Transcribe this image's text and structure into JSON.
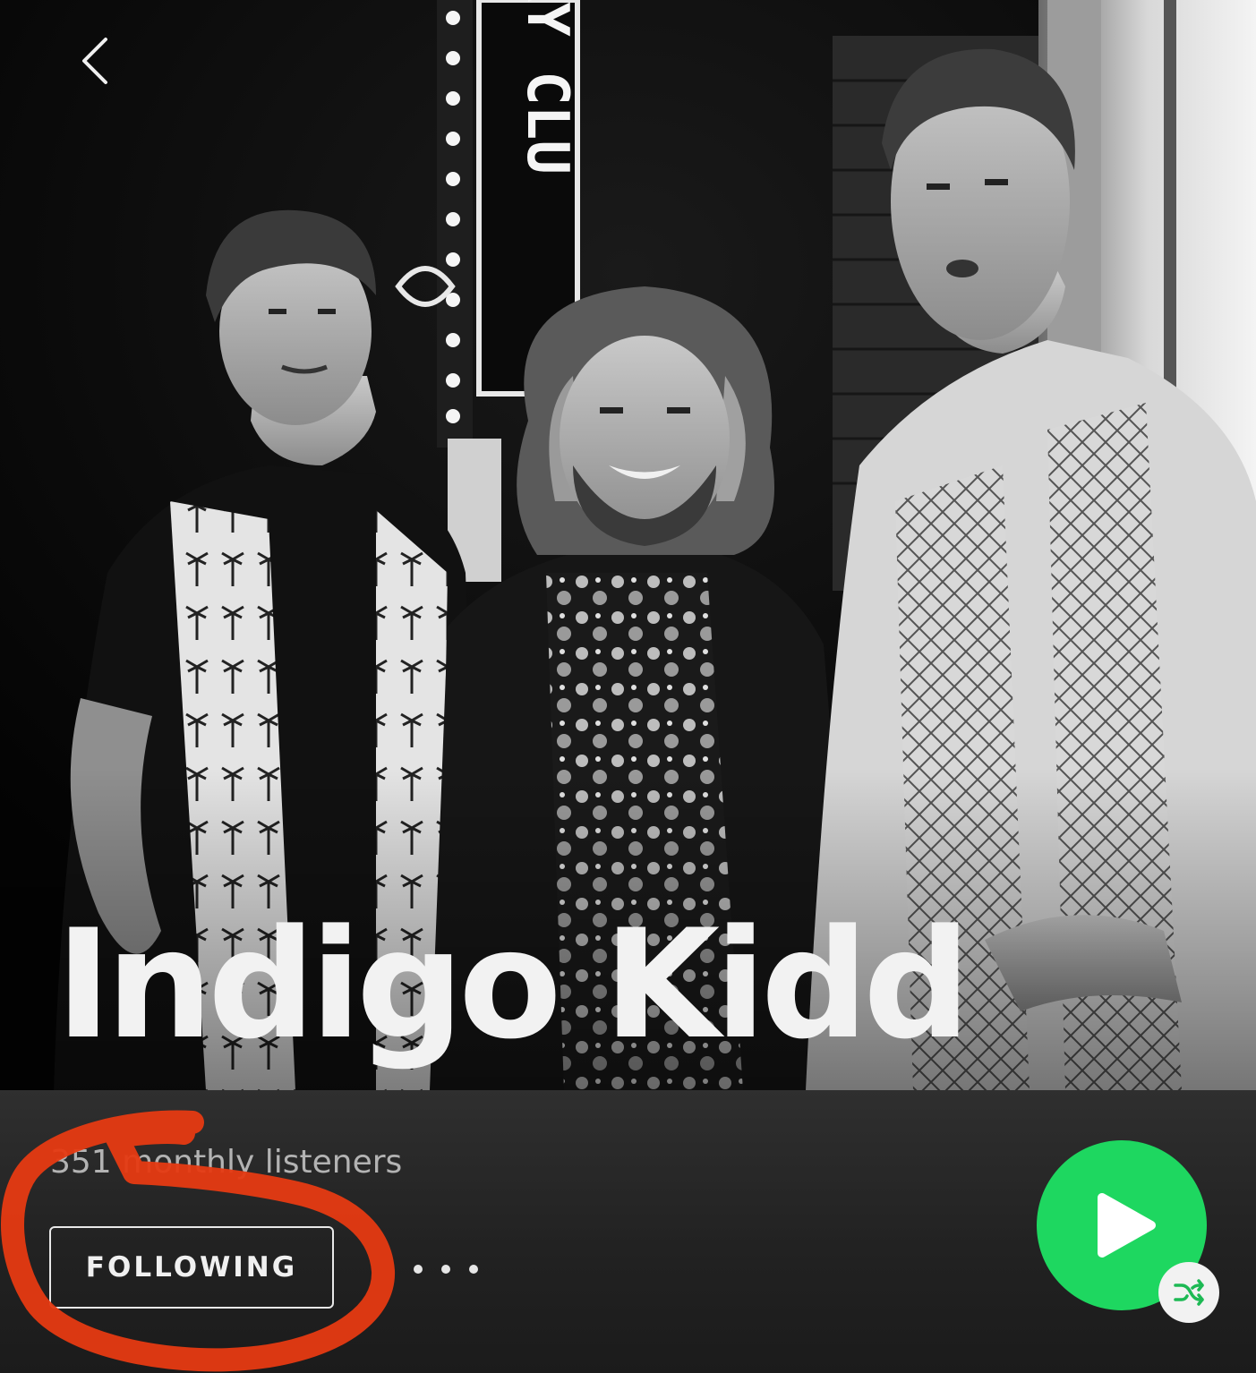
{
  "artist": {
    "name": "Indigo Kidd",
    "monthly_listeners": "351 monthly listeners"
  },
  "hero": {
    "sign_text": "TRY CLU"
  },
  "actions": {
    "follow_label": "FOLLOWING",
    "more_icon": "more-horizontal-icon",
    "play_icon": "play-icon",
    "shuffle_icon": "shuffle-icon"
  },
  "navigation": {
    "back_icon": "chevron-left-icon"
  },
  "colors": {
    "background": "#121212",
    "action_bar": "#282828",
    "accent_green": "#1ed760",
    "shuffle_icon": "#1db954",
    "annotation_red": "#e63a12",
    "text_primary": "#f2f2f2",
    "text_secondary": "#b3b3b3"
  }
}
